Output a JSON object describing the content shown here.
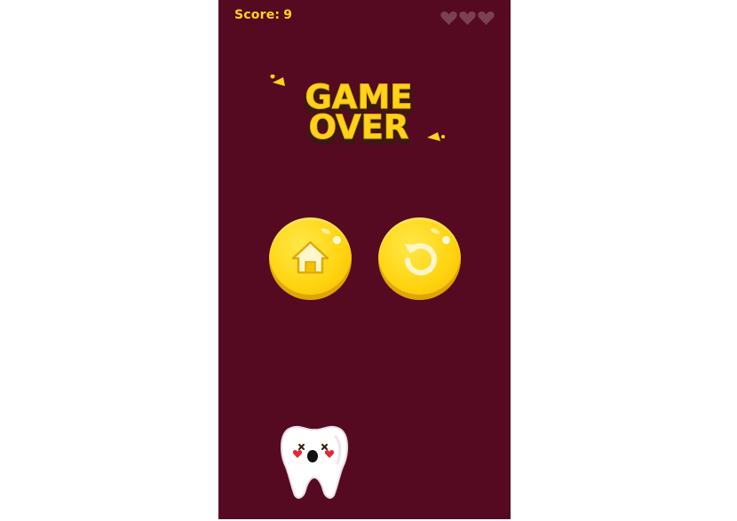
{
  "hud": {
    "score_label": "Score:",
    "score_value": "9",
    "lives_total": 3,
    "lives_remaining": 0
  },
  "title": {
    "line1": "GAME",
    "line2": "OVER"
  },
  "buttons": {
    "home_icon": "house-icon",
    "restart_icon": "restart-arrow-icon"
  },
  "character": {
    "name": "tooth",
    "state": "dizzy"
  },
  "colors": {
    "background": "#560a22",
    "accent": "#ffd21c",
    "title_shadow": "#3a1a10",
    "heart_empty": "#7d4052"
  }
}
